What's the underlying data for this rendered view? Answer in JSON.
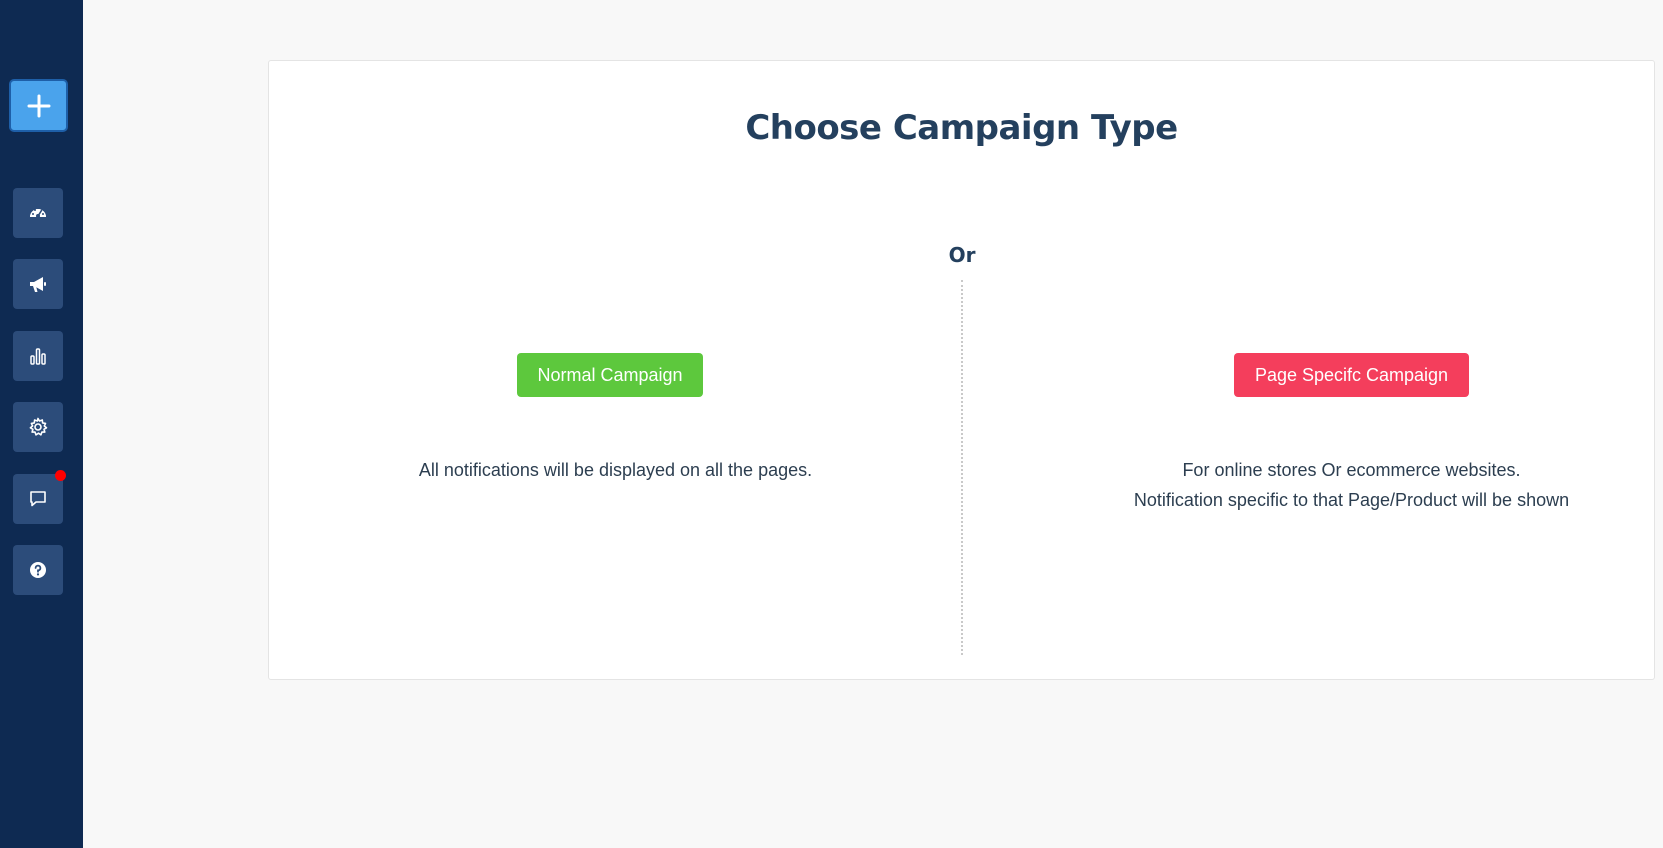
{
  "sidebar": {
    "add_button": {
      "icon": "plus-icon"
    },
    "items": [
      {
        "name": "dashboard",
        "icon": "speedometer-icon"
      },
      {
        "name": "campaigns",
        "icon": "megaphone-icon"
      },
      {
        "name": "analytics",
        "icon": "bar-chart-icon"
      },
      {
        "name": "settings",
        "icon": "gear-icon"
      },
      {
        "name": "messages",
        "icon": "chat-icon",
        "has_notification": true
      },
      {
        "name": "help",
        "icon": "question-icon"
      }
    ],
    "colors": {
      "background": "#0e2a52",
      "item": "#2c4c7a",
      "add": "#4aa3ec",
      "notification": "#ff0000"
    }
  },
  "main": {
    "title": "Choose Campaign Type",
    "separator": "Or",
    "options": [
      {
        "button_label": "Normal Campaign",
        "color": "#5dc83d",
        "description": [
          "All notifications will be displayed on all the pages."
        ]
      },
      {
        "button_label": "Page Specifc Campaign",
        "color": "#f43e5c",
        "description": [
          "For online stores Or ecommerce websites.",
          "Notification specific to that Page/Product will be shown"
        ]
      }
    ]
  }
}
